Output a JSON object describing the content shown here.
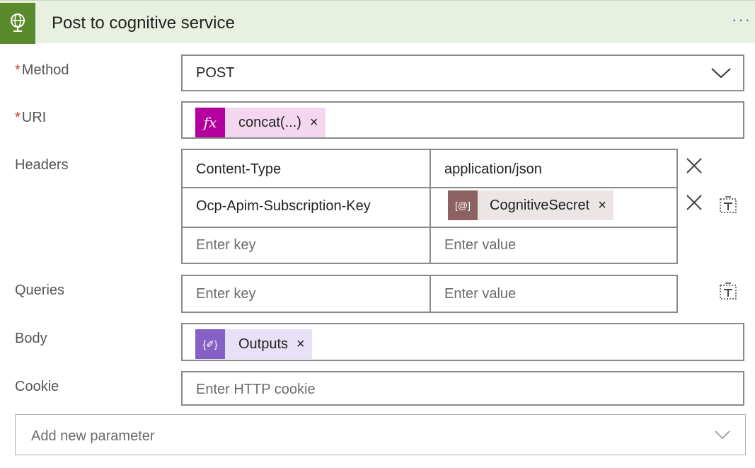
{
  "header": {
    "title": "Post to cognitive service",
    "icon": "globe-icon",
    "more_label": "···"
  },
  "method": {
    "label": "Method",
    "required_mark": "*",
    "value": "POST"
  },
  "uri": {
    "label": "URI",
    "required_mark": "*",
    "token": {
      "icon": "function-icon",
      "icon_text": "fx",
      "label": "concat(...)",
      "remove": "×",
      "color": "#b4009e"
    }
  },
  "headers": {
    "label": "Headers",
    "rows": [
      {
        "key": "Content-Type",
        "value": "application/json"
      },
      {
        "key": "Ocp-Apim-Subscription-Key",
        "value_token": {
          "icon": "parameter-icon",
          "icon_text": "[@]",
          "label": "CognitiveSecret",
          "remove": "×",
          "color": "#8c6262"
        }
      }
    ],
    "empty_row": {
      "key_placeholder": "Enter key",
      "value_placeholder": "Enter value"
    }
  },
  "queries": {
    "label": "Queries",
    "key_placeholder": "Enter key",
    "value_placeholder": "Enter value"
  },
  "body": {
    "label": "Body",
    "token": {
      "icon": "compose-icon",
      "icon_text": "{✐}",
      "label": "Outputs",
      "remove": "×",
      "color": "#8661c5"
    }
  },
  "cookie": {
    "label": "Cookie",
    "placeholder": "Enter HTTP cookie"
  },
  "add_parameter": {
    "placeholder": "Add new parameter"
  }
}
